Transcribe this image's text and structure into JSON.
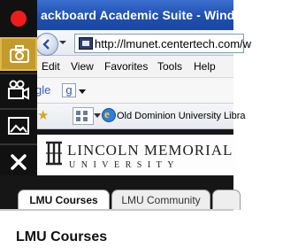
{
  "window": {
    "title": "ackboard Academic Suite - Windows"
  },
  "address_bar": {
    "url": "http://lmunet.centertech.com/w"
  },
  "menu": {
    "items": [
      "Edit",
      "View",
      "Favorites",
      "Tools",
      "Help"
    ]
  },
  "search_bar": {
    "engine_text": "gle"
  },
  "favorites_bar": {
    "link_label": "Old Dominion University Libra"
  },
  "page": {
    "logo_line1": "LINCOLN MEMORIAL",
    "logo_line2": "UNIVERSITY",
    "tabs": [
      {
        "label": "LMU Courses",
        "active": true
      },
      {
        "label": "LMU Community",
        "active": false
      }
    ],
    "heading": "LMU Courses"
  },
  "palette": {
    "tools": [
      "record-icon",
      "camera-icon",
      "video-camera-icon",
      "image-icon",
      "close-icon"
    ],
    "active_tool": "camera-icon",
    "colors": {
      "record": "#ee1c1c",
      "active": "#c39a2c"
    }
  }
}
